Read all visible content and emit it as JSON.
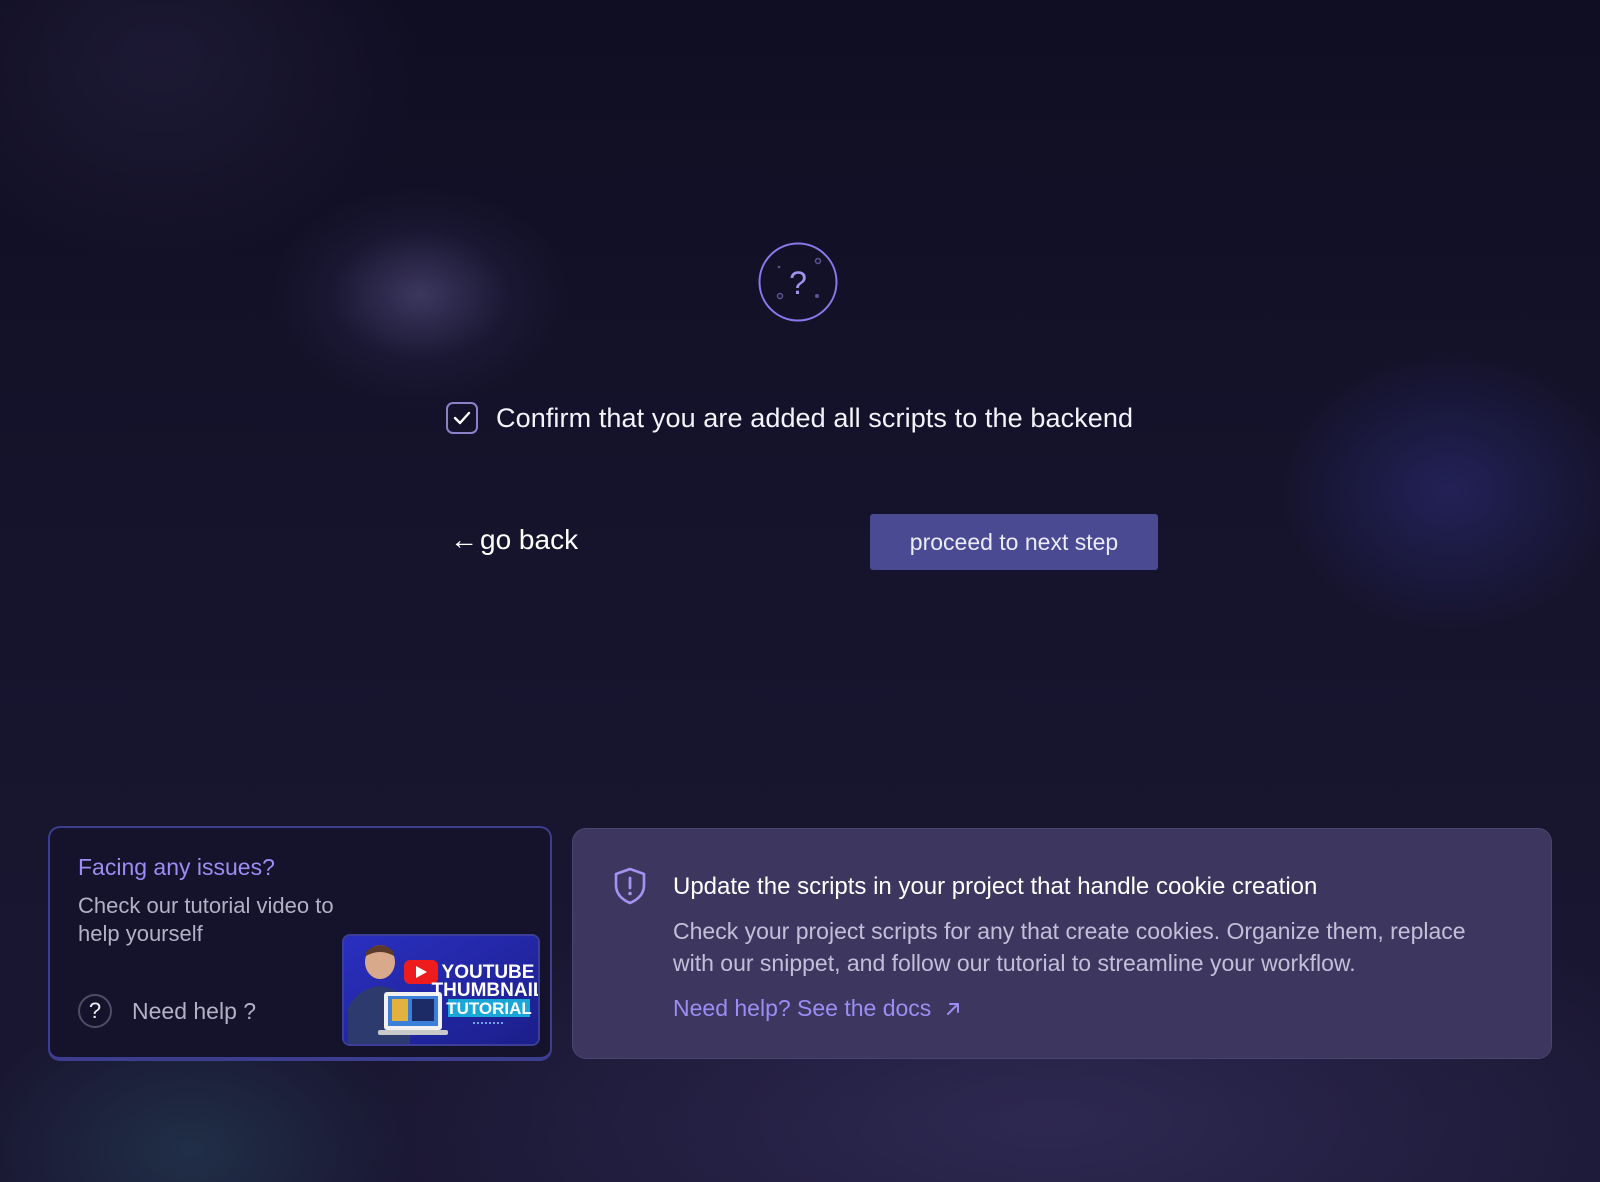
{
  "confirm": {
    "checked": true,
    "label": "Confirm that you are added all scripts to the backend"
  },
  "nav": {
    "back_arrow": "←",
    "back_label": "go back",
    "proceed_label": "proceed to next step"
  },
  "help_card": {
    "title": "Facing any issues?",
    "subtitle": "Check our tutorial video to help yourself",
    "need_help_icon": "?",
    "need_help_label": "Need help ?",
    "video": {
      "line1": "YOUTUBE",
      "line2": "THUMBNAIL",
      "line3": "TUTORIAL"
    }
  },
  "info_card": {
    "title": "Update the scripts in your project that handle cookie creation",
    "body": "Check your project scripts for any that create cookies. Organize them, replace with our snippet, and follow our tutorial to streamline your workflow.",
    "link_label": "Need help? See the docs"
  },
  "colors": {
    "background": "#13112a",
    "accent": "#9b8df3",
    "button": "#4a4a93",
    "info_card_bg": "#3d3760"
  },
  "icons": [
    "help-circle-icon",
    "check-icon",
    "arrow-left-icon",
    "question-icon",
    "play-icon",
    "shield-alert-icon",
    "arrow-up-right-icon"
  ]
}
